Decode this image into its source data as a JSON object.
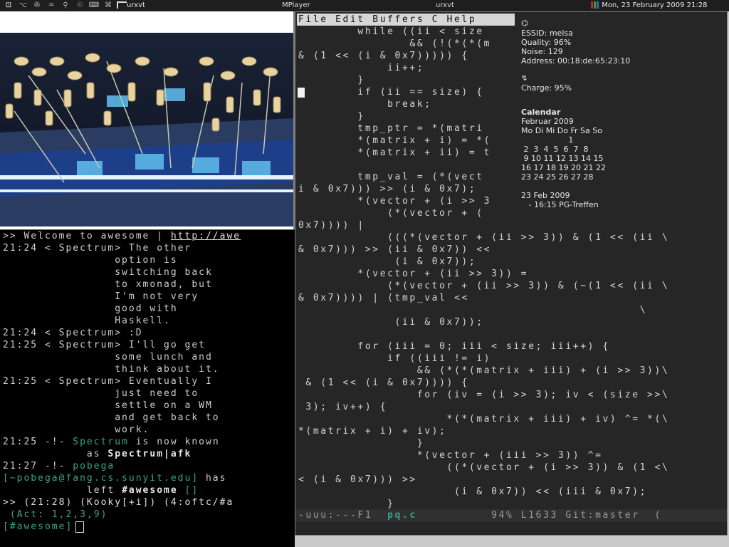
{
  "topbar": {
    "tag_glyphs": [
      "⊡",
      "⌥",
      "✇",
      "♒",
      "⚲",
      "☉",
      "⌨",
      "⌘"
    ],
    "focused_title": "urxvt",
    "tasks": [
      "MPlayer",
      "urxvt"
    ],
    "datetime": "Mon, 23 February 2009 21:28",
    "meter_colors": [
      "#c02a2a",
      "#2fa02f",
      "#2f6fb0"
    ]
  },
  "video": {
    "title": "MPlayer"
  },
  "irc": {
    "lines": [
      {
        "time": "",
        "text": ">> Welcome to awesome | ",
        "link": "http://awe"
      },
      {
        "time": "21:24",
        "text": " < Spectrum> The other"
      },
      {
        "time": "",
        "text": "                option is"
      },
      {
        "time": "",
        "text": "                switching back"
      },
      {
        "time": "",
        "text": "                to xmonad, but"
      },
      {
        "time": "",
        "text": "                I'm not very"
      },
      {
        "time": "",
        "text": "                good with"
      },
      {
        "time": "",
        "text": "                Haskell."
      },
      {
        "time": "21:24",
        "text": " < Spectrum> :D"
      },
      {
        "time": "21:25",
        "text": " < Spectrum> I'll go get"
      },
      {
        "time": "",
        "text": "                some lunch and"
      },
      {
        "time": "",
        "text": "                think about it."
      },
      {
        "time": "21:25",
        "text": " < Spectrum> Eventually I"
      },
      {
        "time": "",
        "text": "                just need to"
      },
      {
        "time": "",
        "text": "                settle on a WM"
      },
      {
        "time": "",
        "text": "                and get back to"
      },
      {
        "time": "",
        "text": "                work."
      }
    ],
    "nick_change": {
      "time": "21:25",
      "prefix": " -!- ",
      "old": "Spectrum",
      "mid": " is now known",
      "as": "as ",
      "new": "Spectrum|afk"
    },
    "part": {
      "time": "21:27",
      "prefix": " -!- ",
      "nick": "pobega",
      "host": "[~pobega@fang.cs.sunyit.edu]",
      "msg": " has",
      "left": "left ",
      "channel": "#awesome",
      "tail": " []"
    },
    "status1": ">> (21:28) (Kooky[+i]) (4:oftc/#a",
    "status2": " (Act: 1,2,3,9)",
    "input_prompt": "[#awesome]"
  },
  "emacs": {
    "menu": "File Edit Buffers C Help",
    "lines": [
      "        while ((ii < size",
      "               && (!(*(*(m",
      "& (1 << (i & 0x7))))) {",
      "            ii++;",
      "        }",
      "        if (ii == size) {",
      "            break;",
      "        }",
      "        tmp_ptr = *(matri",
      "        *(matrix + i) = *(",
      "        *(matrix + ii) = t",
      "",
      "        tmp_val = (*(vect",
      "i & 0x7))) >> (i & 0x7);",
      "        *(vector + (i >> 3",
      "            (*(vector + (",
      "0x7)))) |",
      "            (((*(vector + (ii >> 3)) & (1 << (ii \\",
      "& 0x7))) >> (ii & 0x7)) <<",
      "             (i & 0x7));",
      "        *(vector + (ii >> 3)) =",
      "            (*(vector + (ii >> 3)) & (~(1 << (ii \\",
      "& 0x7)))) | (tmp_val <<",
      "                                              \\",
      "             (ii & 0x7));",
      "",
      "        for (iii = 0; iii < size; iii++) {",
      "            if ((iii != i)",
      "                && (*(*(matrix + iii) + (i >> 3))\\",
      " & (1 << (i & 0x7)))) {",
      "                for (iv = (i >> 3); iv < (size >>\\",
      " 3); iv++) {",
      "                    *(*(matrix + iii) + iv) ^= *(\\",
      "*(matrix + i) + iv);",
      "                }",
      "                *(vector + (iii >> 3)) ^=",
      "                    ((*(vector + (i >> 3)) & (1 <\\",
      "< (i & 0x7))) >>",
      "                     (i & 0x7)) << (iii & 0x7);",
      "            }"
    ],
    "modeline_left": "-uuu:---F1  ",
    "modeline_buffer": "pq.c",
    "modeline_right": "          94% L1633 Git:master  ("
  },
  "conky": {
    "wifi_icon": "⌬",
    "essid": "ESSID: melsa",
    "quality": "Quality: 96%",
    "noise": "Noise: 129",
    "address": "Address: 00:18:de:65:23:10",
    "battery_icon": "↯",
    "charge": "Charge: 95%",
    "calendar_title": "Calendar",
    "month": "Februar 2009",
    "weekdays": "Mo Di Mi Do Fr Sa So",
    "weeks": [
      "                   1",
      " 2  3  4  5  6  7  8",
      " 9 10 11 12 13 14 15",
      "16 17 18 19 20 21 22",
      "23 24 25 26 27 28"
    ],
    "event_date": "23 Feb 2009",
    "event": "   - 16:15 PG-Treffen"
  }
}
